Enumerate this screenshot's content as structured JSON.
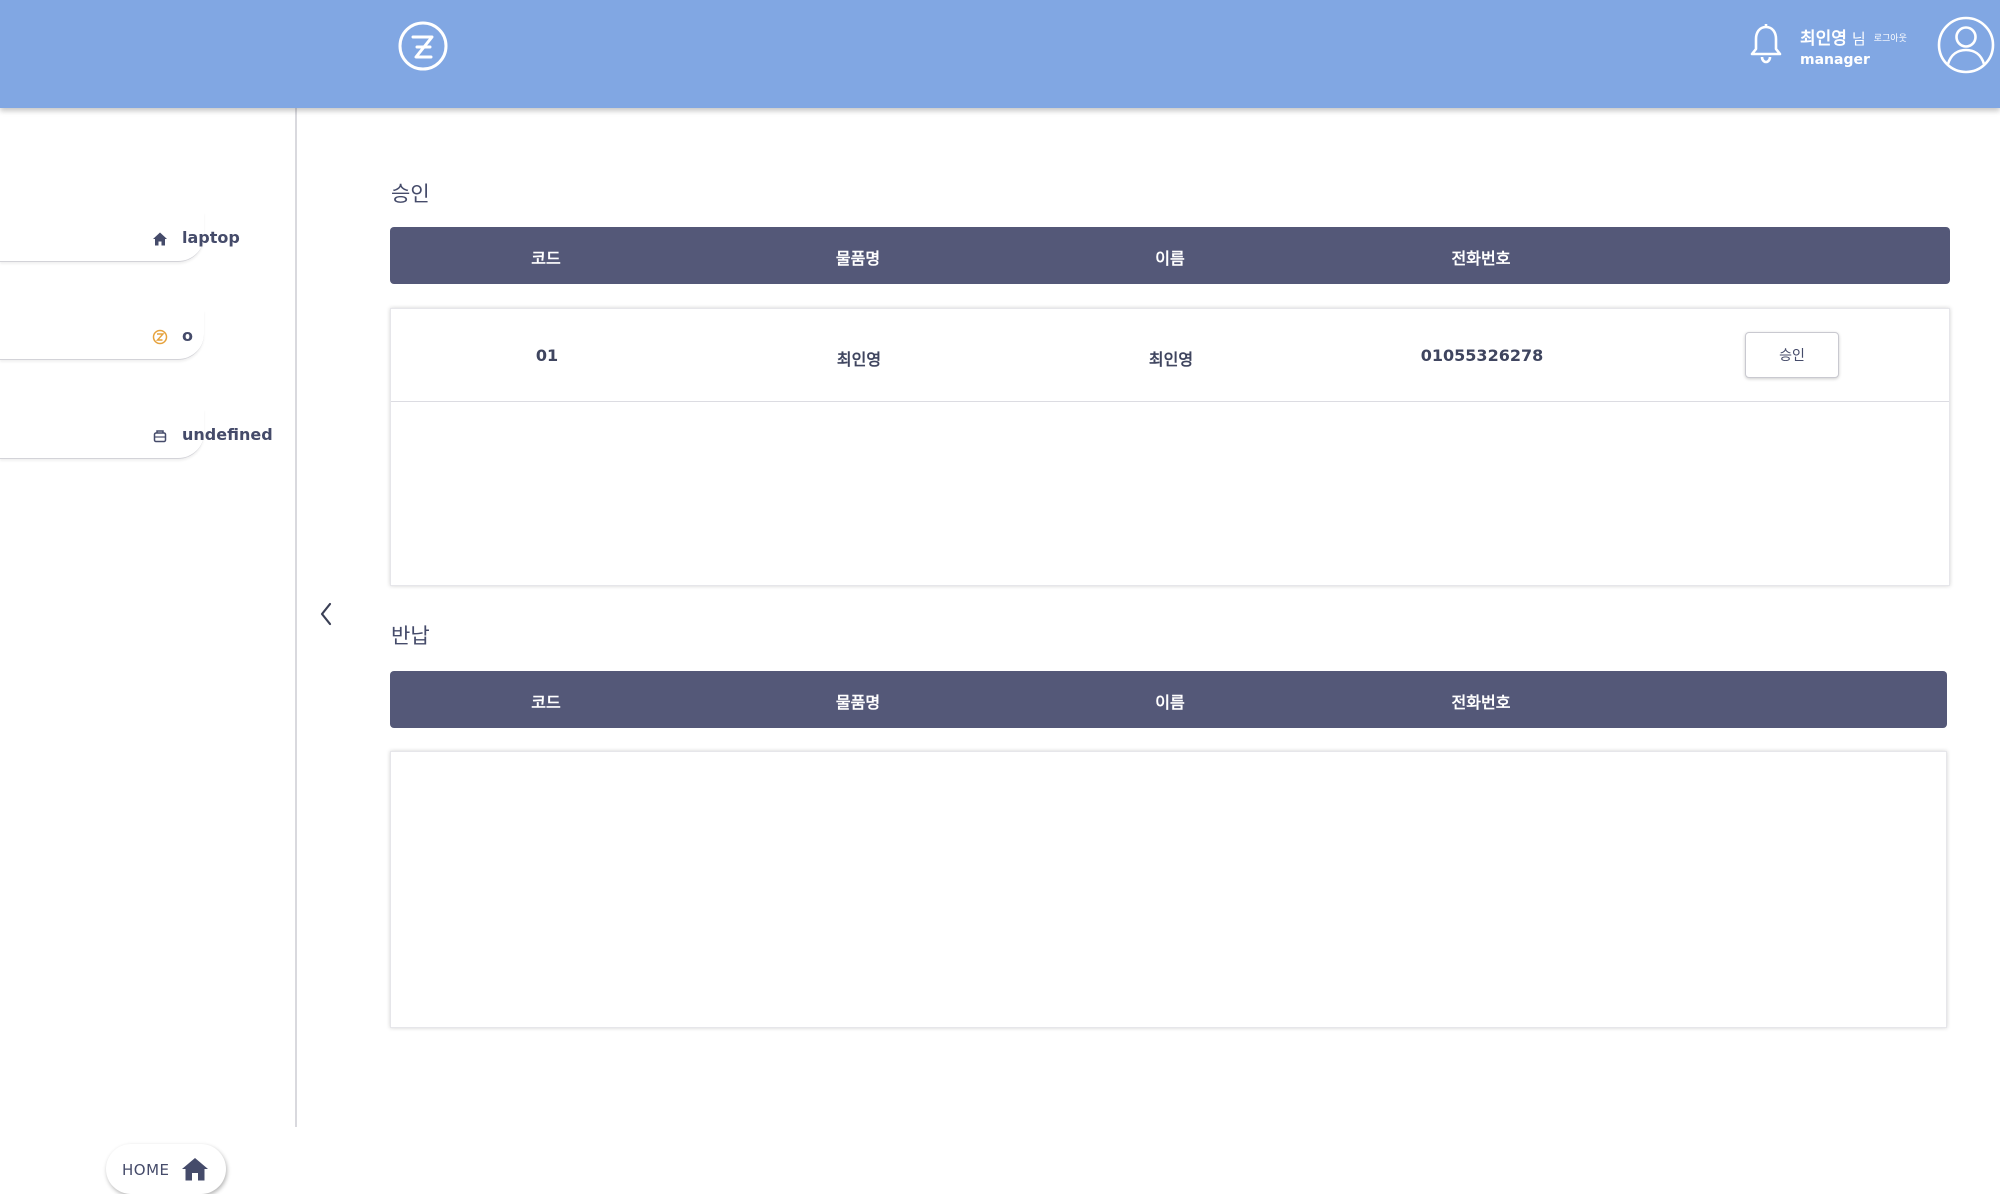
{
  "header": {
    "logo_icon": "logo-circle-icon",
    "user_name": "최인영",
    "user_suffix": "님",
    "logout_label": "로그아웃",
    "user_role": "manager",
    "bell_icon": "bell-icon",
    "avatar_icon": "user-avatar-icon"
  },
  "sidebar": {
    "items": [
      {
        "label": "laptop",
        "icon": "home-icon",
        "icon_color": "#454b6a"
      },
      {
        "label": "o",
        "icon": "logo-small-icon",
        "icon_color": "#e6a23c"
      },
      {
        "label": "undefined",
        "icon": "box-icon",
        "icon_color": "#454b6a"
      }
    ],
    "home_label": "HOME",
    "collapse_icon": "chevron-left-icon"
  },
  "approval": {
    "title": "승인",
    "columns": [
      "코드",
      "물품명",
      "이름",
      "전화번호"
    ],
    "rows": [
      {
        "code": "01",
        "item": "최인영",
        "name": "최인영",
        "phone": "01055326278",
        "action": "승인"
      }
    ]
  },
  "return": {
    "title": "반납",
    "columns": [
      "코드",
      "물품명",
      "이름",
      "전화번호"
    ],
    "rows": []
  },
  "colors": {
    "header_bg": "#81a7e3",
    "table_header_bg": "#545878",
    "text": "#454b6a",
    "accent_orange": "#e6a23c"
  }
}
